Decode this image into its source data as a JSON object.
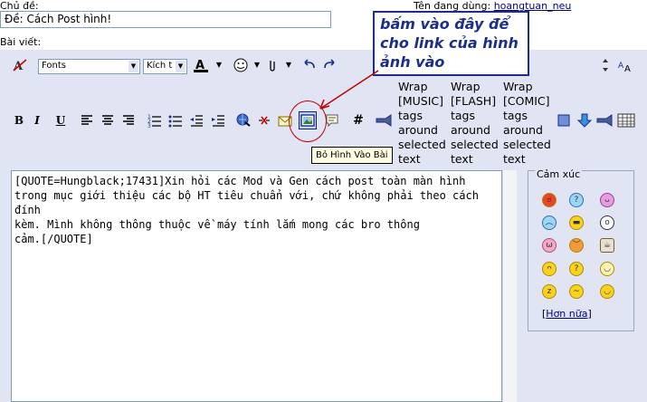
{
  "form": {
    "subject_label": "Chủ đề:",
    "subject_value": "Đề: Cách Post hình!",
    "username_label": "Tên đang dùng:",
    "username_value": "hoangtuan_neu",
    "post_label": "Bài viết:"
  },
  "toolbar": {
    "font_select": "Fonts",
    "size_select": "Kích t",
    "wrap_music": [
      "Wrap",
      "[MUSIC]",
      "tags",
      "around",
      "selected",
      "text"
    ],
    "wrap_flash": [
      "Wrap",
      "[FLASH]",
      "tags",
      "around",
      "selected",
      "text"
    ],
    "wrap_comic": [
      "Wrap",
      "[COMIC]",
      "tags",
      "around",
      "selected",
      "text"
    ],
    "bold_glyph": "B",
    "italic_glyph": "I",
    "underline_glyph": "U",
    "hash_glyph": "#"
  },
  "tooltip": "Bỏ Hình Vào Bài",
  "annotation": [
    "bấm vào đây để",
    "cho link của hình",
    "ảnh vào"
  ],
  "editor": {
    "lines": [
      "[QUOTE=Hungblack;17431]Xin hỏi các Mod và Gen cách post toàn màn hình",
      "trong mục giới thiệu các bộ HT tiêu chuẩn với, chứ không phải theo cách đính",
      "kèm. Mình không thông thuộc về máy tính lắm mong các bro thông",
      "cảm.[/QUOTE]"
    ]
  },
  "smilies": {
    "legend": "Cảm xúc",
    "more_prefix": "[",
    "more_link": "Hơn nữa",
    "more_suffix": "]",
    "icons": [
      "mad",
      "confused",
      "tongue",
      "frown",
      "cool",
      "eek",
      "pig",
      "angry",
      "coffee",
      "thinking",
      "huh",
      "angel",
      "sleepy",
      "sigh",
      "wave"
    ]
  },
  "colors": {
    "panel_bg": "#E1E4F2",
    "annotation": "#1C2E8C",
    "circle": "#C00000",
    "link": "#000080"
  }
}
